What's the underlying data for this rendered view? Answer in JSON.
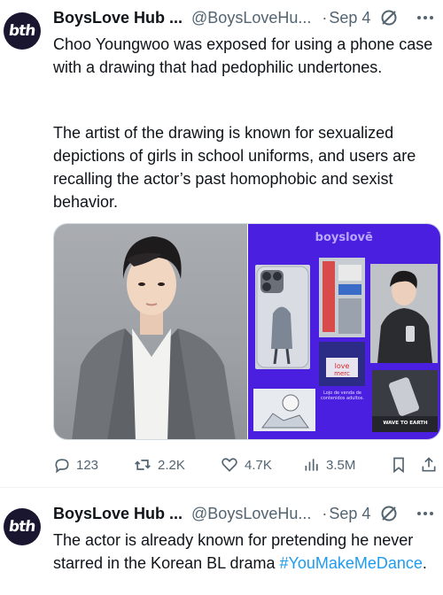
{
  "tweets": [
    {
      "avatar_text": "bth",
      "author": "BoysLove Hub ...",
      "handle": "@BoysLoveHu...",
      "separator": "·",
      "date": "Sep 4",
      "text_p1": "Choo Youngwoo was exposed for using a phone case with a drawing that had pedophilic undertones.",
      "text_p2": "The artist of the drawing is known for sexualized depictions of girls in school uniforms, and users are recalling the actor’s past homophobic and sexist behavior.",
      "media": {
        "brand": "boyslovē",
        "caption_sign": "Lojo de venda de contenidos adultos.",
        "caption_banner": "WAVE TO EARTH"
      },
      "actions": {
        "replies": "123",
        "retweets": "2.2K",
        "likes": "4.7K",
        "views": "3.5M"
      }
    },
    {
      "avatar_text": "bth",
      "author": "BoysLove Hub ...",
      "handle": "@BoysLoveHu...",
      "separator": "·",
      "date": "Sep 4",
      "text_before": "The actor is already known for pretending he never starred in the Korean BL drama ",
      "hashtag": "#YouMakeMeDance",
      "text_after": "."
    }
  ],
  "colors": {
    "text": "#0f1419",
    "muted": "#536471",
    "link": "#1d9bf0",
    "brand_purple": "#4b1fe0"
  },
  "icons": [
    "grok-icon",
    "more-icon",
    "reply-icon",
    "retweet-icon",
    "like-icon",
    "views-icon",
    "bookmark-icon",
    "share-icon"
  ]
}
